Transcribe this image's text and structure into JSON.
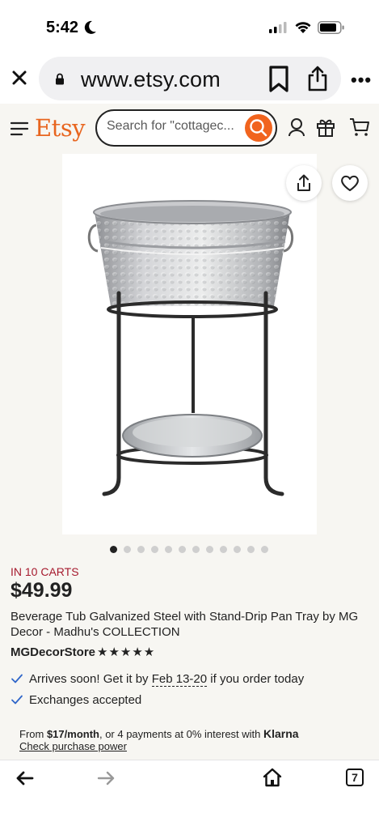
{
  "status_bar": {
    "time": "5:42"
  },
  "browser": {
    "url": "www.etsy.com",
    "tab_count": "7"
  },
  "header": {
    "logo": "Etsy",
    "search_placeholder": "Search for \"cottagec..."
  },
  "gallery": {
    "image_count": 12,
    "active_index": 0
  },
  "product": {
    "carts_badge": "IN 10 CARTS",
    "price": "$49.99",
    "title": "Beverage Tub Galvanized Steel with Stand-Drip Pan Tray by MG Decor - Madhu's COLLECTION",
    "shop_name": "MGDecorStore",
    "rating_stars": 5,
    "stars_text": "★★★★★",
    "shipping_prefix": "Arrives soon! Get it by ",
    "shipping_dates": "Feb 13-20",
    "shipping_suffix": " if you order today",
    "exchanges": "Exchanges accepted"
  },
  "klarna": {
    "prefix": "From ",
    "monthly": "$17/month",
    "middle": ", or 4 payments at 0% interest with ",
    "brand": "Klarna",
    "link": "Check purchase power"
  },
  "colors": {
    "etsy_orange": "#f1641e",
    "carts_red": "#a61a2e",
    "check_blue": "#2f66c9",
    "page_bg": "#f7f6f2"
  }
}
